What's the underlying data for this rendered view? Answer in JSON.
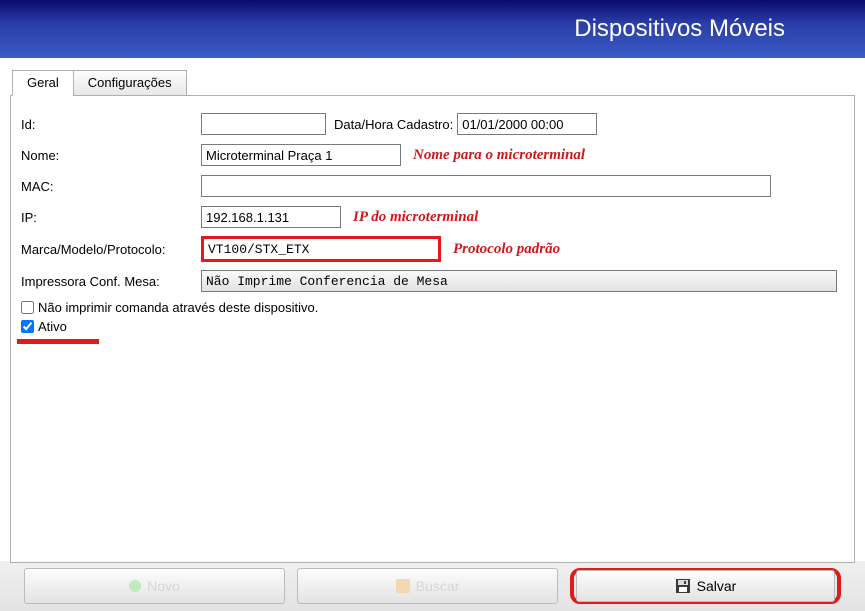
{
  "header": {
    "title": "Dispositivos Móveis"
  },
  "tabs": [
    {
      "label": "Geral",
      "active": true
    },
    {
      "label": "Configurações",
      "active": false
    }
  ],
  "form": {
    "id_label": "Id:",
    "id_value": "",
    "data_label": "Data/Hora Cadastro:",
    "data_value": "01/01/2000 00:00",
    "nome_label": "Nome:",
    "nome_value": "Microterminal Praça 1",
    "nome_annot": "Nome para o microterminal",
    "mac_label": "MAC:",
    "mac_value": "",
    "ip_label": "IP:",
    "ip_value": "192.168.1.131",
    "ip_annot": "IP do microterminal",
    "protocolo_label": "Marca/Modelo/Protocolo:",
    "protocolo_value": "VT100/STX_ETX",
    "protocolo_annot": "Protocolo padrão",
    "impressora_label": "Impressora Conf. Mesa:",
    "impressora_value": "Não Imprime Conferencia de Mesa",
    "chk_nao_imprimir_label": "Não imprimir comanda através deste dispositivo.",
    "chk_nao_imprimir_checked": false,
    "chk_ativo_label": "Ativo",
    "chk_ativo_checked": true
  },
  "buttons": {
    "novo": "Novo",
    "buscar": "Buscar",
    "salvar": "Salvar"
  }
}
